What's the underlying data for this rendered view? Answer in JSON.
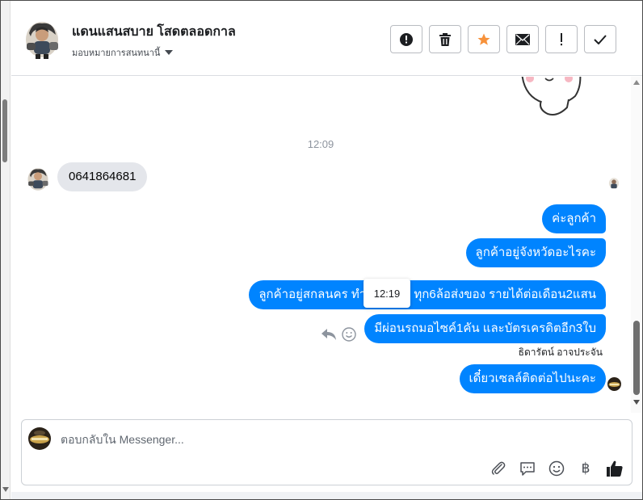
{
  "header": {
    "title": "แดนแสนสบาย โสดตลอดกาล",
    "assign_label": "มอบหมายการสนทนานี้",
    "actions": [
      {
        "name": "mark-spam-button",
        "icon": "alert-circle-icon"
      },
      {
        "name": "delete-button",
        "icon": "trash-icon"
      },
      {
        "name": "star-button",
        "icon": "star-icon"
      },
      {
        "name": "mark-unread-button",
        "icon": "envelope-icon"
      },
      {
        "name": "follow-up-button",
        "icon": "exclamation-icon"
      },
      {
        "name": "mark-done-button",
        "icon": "check-icon"
      }
    ]
  },
  "chat": {
    "timestamp": "12:09",
    "incoming_message": "0641864681",
    "outgoing_messages": [
      "ค่ะลูกค้า",
      "ลูกค้าอยู่จังหวัดอะไรคะ",
      "ลูกค้าอยู่สกลนคร ทำอาชีพรับ ทุก6ล้อส่งของ รายได้ต่อเดือน2แสน",
      "มีผ่อนรถมอไซค์1คัน และบัตรเครดิตอีก3ใบ",
      "เดี๋ยวเซลล์ติดต่อไปนะคะ"
    ],
    "hover_tooltip": "12:19",
    "sender_name": "ธิดารัตน์ อาจประจัน"
  },
  "composer": {
    "placeholder": "ตอบกลับใน Messenger...",
    "currency_symbol": "฿"
  },
  "colors": {
    "outgoing_bubble": "#0084ff",
    "incoming_bubble": "#e4e6eb",
    "star": "#f7923b"
  }
}
